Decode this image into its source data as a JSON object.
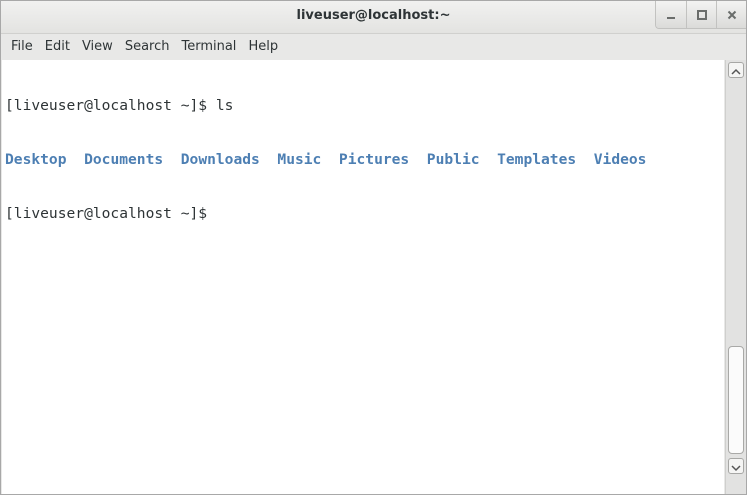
{
  "window": {
    "title": "liveuser@localhost:~",
    "controls": [
      "minimize-icon",
      "maximize-icon",
      "close-icon"
    ]
  },
  "menubar": {
    "items": [
      "File",
      "Edit",
      "View",
      "Search",
      "Terminal",
      "Help"
    ]
  },
  "terminal": {
    "line1": {
      "prompt": "[liveuser@localhost ~]$ ",
      "command": "ls"
    },
    "directories": [
      "Desktop",
      "Documents",
      "Downloads",
      "Music",
      "Pictures",
      "Public",
      "Templates",
      "Videos"
    ],
    "line3": {
      "prompt": "[liveuser@localhost ~]$"
    },
    "colors": {
      "text": "#2e3436",
      "directory": "#4d7fb3",
      "background": "#ffffff"
    }
  }
}
